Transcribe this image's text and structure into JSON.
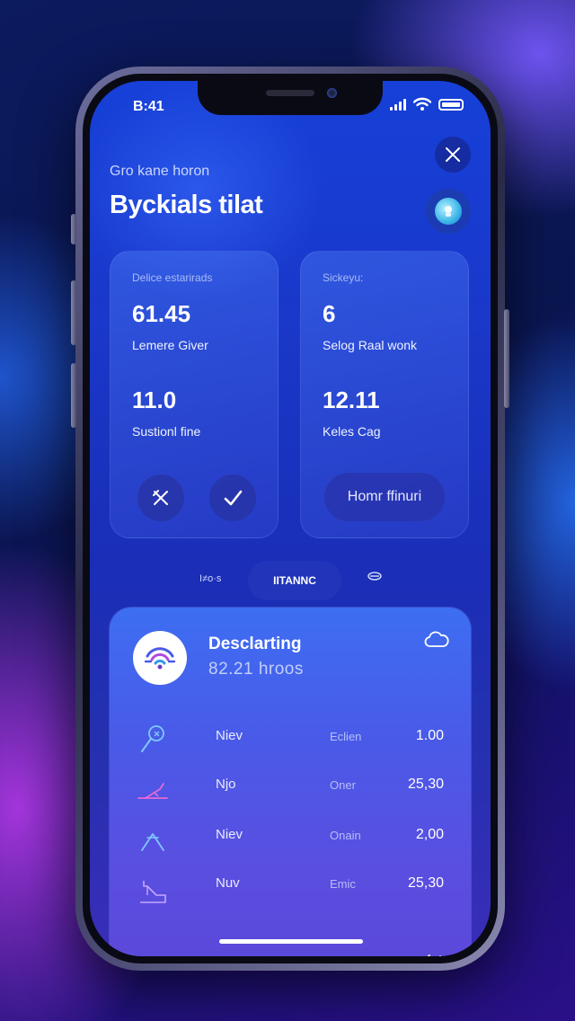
{
  "status_bar": {
    "time": "B:41"
  },
  "header": {
    "subtitle": "Gro kane horon",
    "title": "Byckials tilat"
  },
  "cards": {
    "left": {
      "label": "Delice estarirads",
      "value1": "61.45",
      "caption1": "Lemere Giver",
      "value2": "11.0",
      "caption2": "Sustionl fine"
    },
    "right": {
      "label": "Sickeyu:",
      "value1": "6",
      "caption1": "Selog Raal wonk",
      "value2": "12.11",
      "caption2": "Keles Cag",
      "button_label": "Homr ffinuri"
    }
  },
  "tabs": {
    "left_label": "I≠o·s",
    "active_label": "IITANNC"
  },
  "panel": {
    "title": "Desclarting",
    "subtitle": "82.21  hroos",
    "rows": [
      {
        "name": "Niev",
        "type": "Eclien",
        "amount": "1.00",
        "icon": "pin-icon"
      },
      {
        "name": "Njo",
        "type": "Oner",
        "amount": "25,30",
        "icon": "ramp-icon"
      },
      {
        "name": "Niev",
        "type": "Onain",
        "amount": "2,00",
        "icon": "mountain-icon"
      },
      {
        "name": "Nuv",
        "type": "Emic",
        "amount": "25,30",
        "icon": "slide-icon"
      }
    ]
  },
  "colors": {
    "screen_top": "#1640d8",
    "panel_top": "#3d6ef2",
    "panel_bottom": "#5b48d8",
    "avatar_accent": "#3ab4e8"
  }
}
